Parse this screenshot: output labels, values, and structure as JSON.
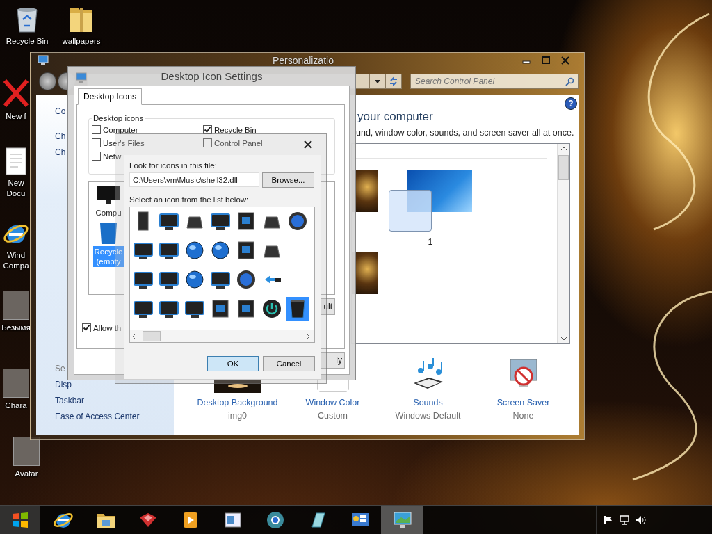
{
  "desktop_icons": [
    {
      "kind": "recycle-bin",
      "label": "Recycle Bin"
    },
    {
      "kind": "folder",
      "label": "wallpapers"
    },
    {
      "kind": "red-x",
      "label": "New f"
    },
    {
      "kind": "document",
      "label": "New Docu"
    },
    {
      "kind": "browser",
      "label": "Wind Compa"
    },
    {
      "kind": "photo",
      "label": "Безымя"
    },
    {
      "kind": "photo",
      "label": "Chara"
    },
    {
      "kind": "photo",
      "label": "Avatar"
    }
  ],
  "personalization": {
    "title": "Personalizatio",
    "search": {
      "placeholder": "Search Control Panel"
    },
    "help": "?",
    "sidebar": {
      "links": [
        "Co",
        "Ch",
        "Ch"
      ],
      "see_also": "Se",
      "see_also_links": [
        "Disp",
        "Taskbar",
        "Ease of Access Center"
      ]
    },
    "heading": "your computer",
    "description": "und, window color, sounds, and screen saver all at once.",
    "theme_label": "1",
    "settings": [
      {
        "kind": "background",
        "label": "Desktop Background",
        "value": "img0"
      },
      {
        "kind": "color",
        "label": "Window Color",
        "value": "Custom"
      },
      {
        "kind": "sounds",
        "label": "Sounds",
        "value": "Windows Default"
      },
      {
        "kind": "screensaver",
        "label": "Screen Saver",
        "value": "None"
      }
    ]
  },
  "icon_settings": {
    "title": "Desktop Icon Settings",
    "tabs": [
      {
        "label": "Desktop Icons",
        "selected": true
      }
    ],
    "group": "Desktop icons",
    "checkboxes": [
      {
        "label": "Computer",
        "checked": false
      },
      {
        "label": "Recycle Bin",
        "checked": true
      },
      {
        "label": "User's Files",
        "checked": false
      },
      {
        "label": "Control Panel",
        "checked": false
      },
      {
        "label": "Netw",
        "checked": false
      }
    ],
    "icons": [
      {
        "kind": "monitor",
        "label": "Compu",
        "selected": false
      },
      {
        "kind": "bin",
        "label": "Recycle (empty",
        "selected": true
      }
    ],
    "allow": {
      "label": "Allow th",
      "checked": true
    },
    "buttons": [
      "ult",
      "ly"
    ]
  },
  "change_icon": {
    "file_label": "Look for icons in this file:",
    "file_path": "C:\\Users\\vm\\Music\\shell32.dll",
    "browse": "Browse...",
    "list_label": "Select an icon from the list below:",
    "icon_rows": [
      [
        {
          "kind": "tower",
          "selected": false
        },
        {
          "kind": "monitor",
          "selected": false
        },
        {
          "kind": "drive",
          "selected": false
        },
        {
          "kind": "monitor",
          "selected": false
        },
        {
          "kind": "screen",
          "selected": false
        },
        {
          "kind": "drive",
          "selected": false
        },
        {
          "kind": "disc",
          "selected": false
        }
      ],
      [
        {
          "kind": "monitor",
          "selected": false
        },
        {
          "kind": "monitor",
          "selected": false
        },
        {
          "kind": "globe",
          "selected": false
        },
        {
          "kind": "globe",
          "selected": false
        },
        {
          "kind": "screen",
          "selected": false
        },
        {
          "kind": "drive",
          "selected": false
        }
      ],
      [
        {
          "kind": "monitor",
          "selected": false
        },
        {
          "kind": "monitor",
          "selected": false
        },
        {
          "kind": "globe",
          "selected": false
        },
        {
          "kind": "monitor",
          "selected": false
        },
        {
          "kind": "disc",
          "selected": false
        },
        {
          "kind": "cable",
          "selected": false
        }
      ],
      [
        {
          "kind": "monitor",
          "selected": false
        },
        {
          "kind": "monitor",
          "selected": false
        },
        {
          "kind": "monitor",
          "selected": false
        },
        {
          "kind": "screen",
          "selected": false
        },
        {
          "kind": "screen",
          "selected": false
        },
        {
          "kind": "power",
          "selected": false
        },
        {
          "kind": "bin",
          "selected": true
        }
      ]
    ],
    "buttons": [
      "OK",
      "Cancel"
    ]
  },
  "taskbar": {
    "apps": [
      {
        "kind": "browser",
        "selected": false
      },
      {
        "kind": "folder",
        "selected": false
      },
      {
        "kind": "boxes",
        "selected": false
      },
      {
        "kind": "media",
        "selected": false
      },
      {
        "kind": "window",
        "selected": false
      },
      {
        "kind": "globe",
        "selected": false
      },
      {
        "kind": "notepad",
        "selected": false
      },
      {
        "kind": "control-panel",
        "selected": false
      },
      {
        "kind": "display",
        "selected": true
      }
    ]
  }
}
